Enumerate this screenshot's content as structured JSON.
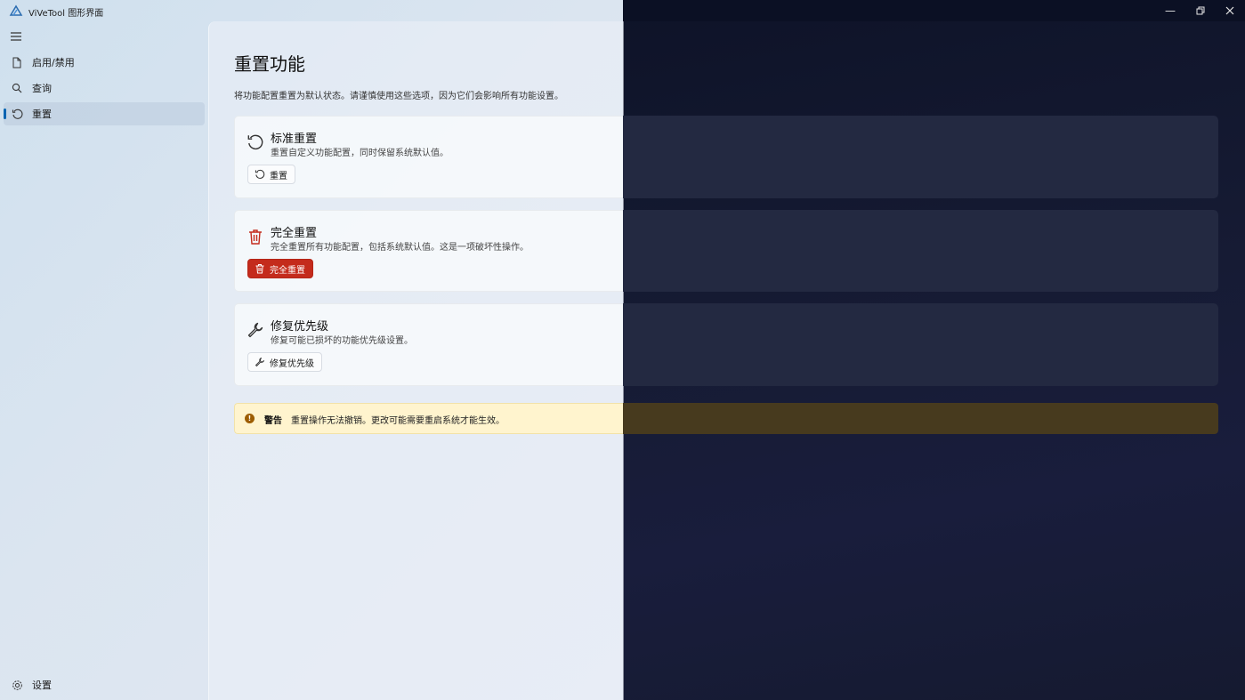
{
  "window": {
    "title": "ViVeTool 图形界面",
    "controls": [
      "minimize-icon",
      "restore-icon",
      "close-icon"
    ]
  },
  "sidebar": {
    "items": [
      {
        "label": "启用/禁用",
        "icon": "document-icon"
      },
      {
        "label": "查询",
        "icon": "search-icon"
      },
      {
        "label": "重置",
        "icon": "reset-icon",
        "active": true
      }
    ],
    "footer": {
      "label": "设置",
      "icon": "gear-icon"
    }
  },
  "main": {
    "title": "重置功能",
    "description": "将功能配置重置为默认状态。请谨慎使用这些选项，因为它们会影响所有功能设置。",
    "cards": [
      {
        "title": "标准重置",
        "description": "重置自定义功能配置，同时保留系统默认值。",
        "button": "重置",
        "icon": "reset-icon"
      },
      {
        "title": "完全重置",
        "description": "完全重置所有功能配置，包括系统默认值。这是一项破坏性操作。",
        "button": "完全重置",
        "icon": "trash-icon",
        "danger": true
      },
      {
        "title": "修复优先级",
        "description": "修复可能已损坏的功能优先级设置。",
        "button": "修复优先级",
        "icon": "wrench-icon"
      }
    ],
    "warning": {
      "title": "警告",
      "text": "重置操作无法撤销。更改可能需要重启系统才能生效。"
    }
  },
  "colors": {
    "accent": "#0063b1",
    "danger": "#c42b1c",
    "warning_bg": "#fff4ce",
    "dark_bg": "#141a30"
  }
}
